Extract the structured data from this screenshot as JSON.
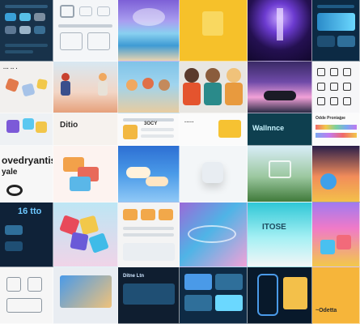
{
  "collage": {
    "caption_1": "ovedryantis",
    "caption_2": "yale",
    "caption_3": "Ditio",
    "caption_4": "Wallnnce",
    "caption_5": "Odde Proniajpe",
    "caption_6": "16 tto",
    "caption_7": "~Odetta",
    "caption_8": "ITOSE",
    "caption_9": "3OCY",
    "caption_10": "Ditne Ltn"
  }
}
